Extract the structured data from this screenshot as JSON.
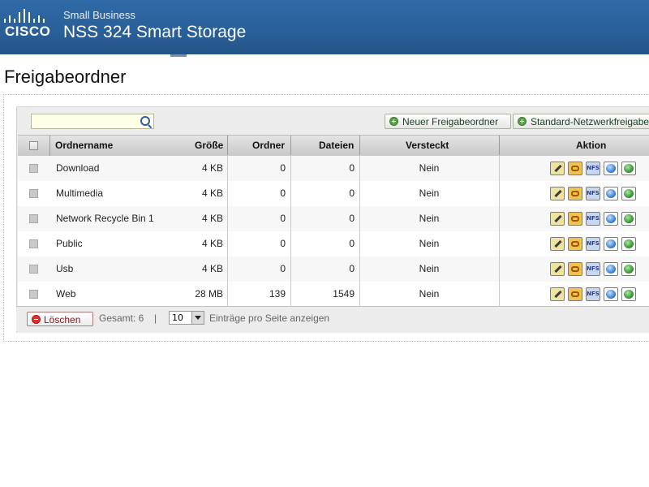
{
  "header": {
    "logo_text": "CISCO",
    "brand_sub": "Small Business",
    "product_title": "NSS 324 Smart Storage"
  },
  "page_title": "Freigabeordner",
  "toolbar": {
    "search_value": "",
    "new_share_label": "Neuer Freigabeordner",
    "default_share_label": "Standard-Netzwerkfreigabe"
  },
  "table": {
    "headers": {
      "name": "Ordnername",
      "size": "Größe",
      "folders": "Ordner",
      "files": "Dateien",
      "hidden": "Versteckt",
      "action": "Aktion"
    },
    "rows": [
      {
        "name": "Download",
        "size": "4 KB",
        "folders": "0",
        "files": "0",
        "hidden": "Nein"
      },
      {
        "name": "Multimedia",
        "size": "4 KB",
        "folders": "0",
        "files": "0",
        "hidden": "Nein"
      },
      {
        "name": "Network Recycle Bin 1",
        "size": "4 KB",
        "folders": "0",
        "files": "0",
        "hidden": "Nein"
      },
      {
        "name": "Public",
        "size": "4 KB",
        "folders": "0",
        "files": "0",
        "hidden": "Nein"
      },
      {
        "name": "Usb",
        "size": "4 KB",
        "folders": "0",
        "files": "0",
        "hidden": "Nein"
      },
      {
        "name": "Web",
        "size": "28 MB",
        "folders": "139",
        "files": "1549",
        "hidden": "Nein"
      }
    ],
    "action_icons": [
      "NFS"
    ]
  },
  "footer": {
    "delete_label": "Löschen",
    "total_text": "Gesamt: 6",
    "separator": "|",
    "per_page_value": "10",
    "per_page_text": "Einträge pro Seite anzeigen"
  },
  "colors": {
    "header_blue": "#2a609a",
    "add_green": "#5aa24a",
    "delete_red": "#d33333"
  }
}
